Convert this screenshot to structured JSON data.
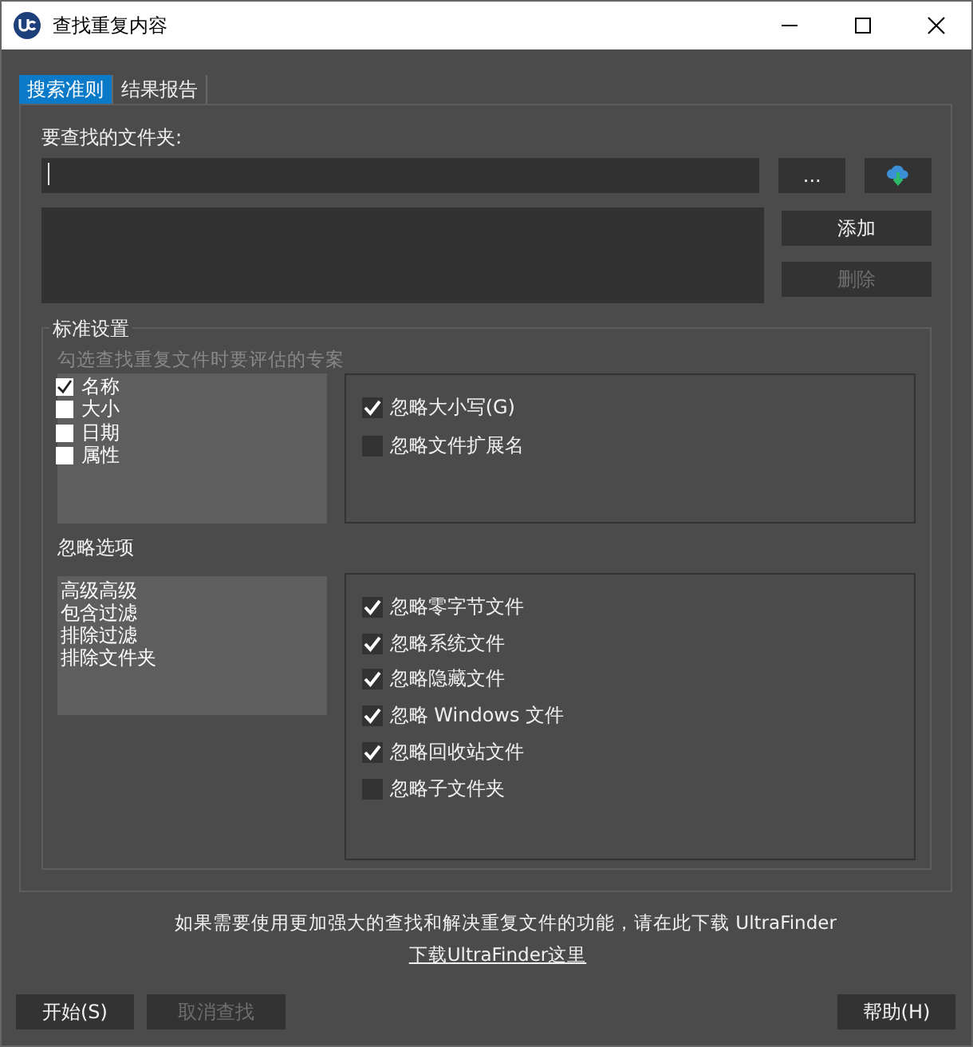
{
  "window": {
    "title": "查找重复内容"
  },
  "tabs": [
    {
      "label": "搜索准则",
      "selected": true
    },
    {
      "label": "结果报告",
      "selected": false
    }
  ],
  "folder": {
    "label": "要查找的文件夹:",
    "browse_button": "...",
    "add_button": {
      "label": "添加",
      "disabled": false
    },
    "remove_button": {
      "label": "删除",
      "disabled": true
    }
  },
  "criteria": {
    "title": "标准设置",
    "hint": "勾选查找重复文件时要评估的专案",
    "items": [
      {
        "label": "名称",
        "checked": true
      },
      {
        "label": "大小",
        "checked": false
      },
      {
        "label": "日期",
        "checked": false
      },
      {
        "label": "属性",
        "checked": false
      }
    ],
    "options": [
      {
        "label": "忽略大小写(G)",
        "checked": true
      },
      {
        "label": "忽略文件扩展名",
        "checked": false
      }
    ]
  },
  "ignore": {
    "title": "忽略选项",
    "items": [
      "高级高级",
      "包含过滤",
      "排除过滤",
      "排除文件夹"
    ],
    "options": [
      {
        "label": "忽略零字节文件",
        "checked": true
      },
      {
        "label": "忽略系统文件",
        "checked": true
      },
      {
        "label": "忽略隐藏文件",
        "checked": true
      },
      {
        "label": "忽略 Windows 文件",
        "checked": true
      },
      {
        "label": "忽略回收站文件",
        "checked": true
      },
      {
        "label": "忽略子文件夹",
        "checked": false
      }
    ]
  },
  "footer": {
    "message": "如果需要使用更加强大的查找和解决重复文件的功能，请在此下载 UltraFinder",
    "link": "下载UltraFinder这里"
  },
  "buttons": [
    {
      "label": "开始(S)",
      "disabled": false
    },
    {
      "label": "取消查找",
      "disabled": true
    }
  ],
  "help_button": {
    "label": "帮助(H)",
    "disabled": false
  }
}
